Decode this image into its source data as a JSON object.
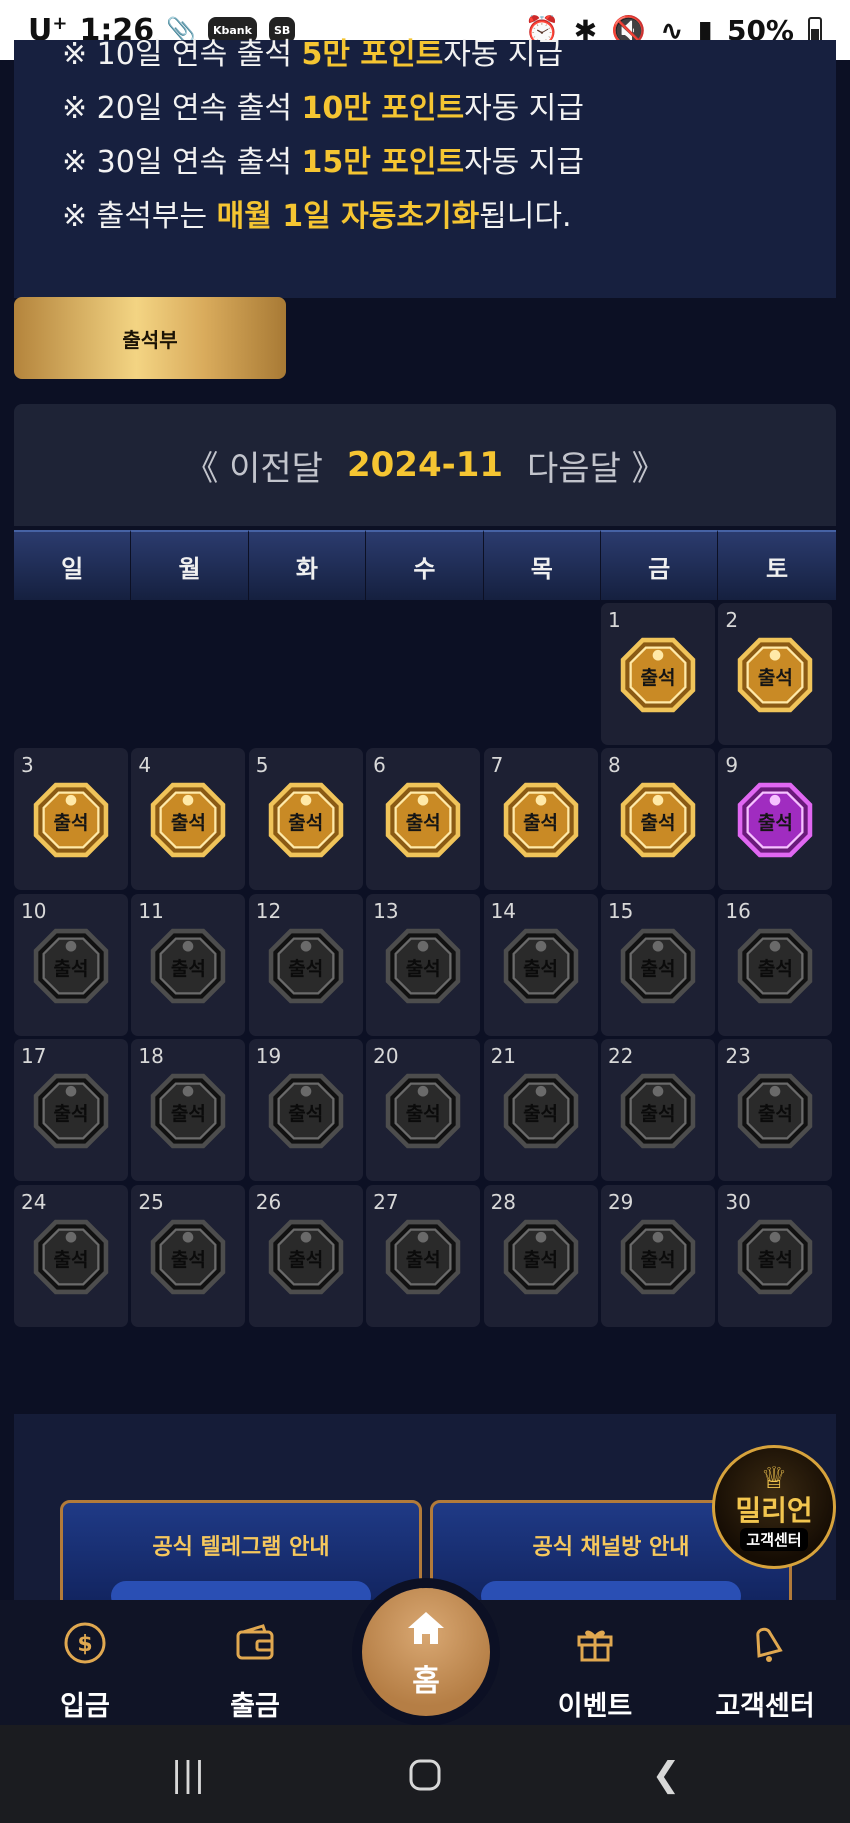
{
  "status_bar": {
    "carrier": "U",
    "carrier_sup": "+",
    "time": "1:26",
    "app_icons": [
      "Kbank",
      "SB"
    ],
    "battery": "50%"
  },
  "notice": {
    "lines": [
      {
        "prefix": "※ 10일 연속 출석 ",
        "highlight": "5만 포인트",
        "suffix": "자동 지급"
      },
      {
        "prefix": "※ 20일 연속 출석 ",
        "highlight": "10만 포인트",
        "suffix": "자동 지급"
      },
      {
        "prefix": "※ 30일 연속 출석 ",
        "highlight": "15만 포인트",
        "suffix": "자동 지급"
      },
      {
        "prefix": "※ 출석부는 ",
        "highlight": "매월 1일 자동초기화",
        "suffix": "됩니다."
      }
    ]
  },
  "attendance_button": "출석부",
  "calendar": {
    "prev_label": "《 이전달",
    "month": "2024-11",
    "next_label": "다음달 》",
    "weekdays": [
      "일",
      "월",
      "화",
      "수",
      "목",
      "금",
      "토"
    ],
    "leading_blank_days": 5,
    "badge_label": "출석",
    "days": [
      {
        "day": "1",
        "state": "gold"
      },
      {
        "day": "2",
        "state": "gold"
      },
      {
        "day": "3",
        "state": "gold"
      },
      {
        "day": "4",
        "state": "gold"
      },
      {
        "day": "5",
        "state": "gold"
      },
      {
        "day": "6",
        "state": "gold"
      },
      {
        "day": "7",
        "state": "gold"
      },
      {
        "day": "8",
        "state": "gold"
      },
      {
        "day": "9",
        "state": "purple"
      },
      {
        "day": "10",
        "state": "gray"
      },
      {
        "day": "11",
        "state": "gray"
      },
      {
        "day": "12",
        "state": "gray"
      },
      {
        "day": "13",
        "state": "gray"
      },
      {
        "day": "14",
        "state": "gray"
      },
      {
        "day": "15",
        "state": "gray"
      },
      {
        "day": "16",
        "state": "gray"
      },
      {
        "day": "17",
        "state": "gray"
      },
      {
        "day": "18",
        "state": "gray"
      },
      {
        "day": "19",
        "state": "gray"
      },
      {
        "day": "20",
        "state": "gray"
      },
      {
        "day": "21",
        "state": "gray"
      },
      {
        "day": "22",
        "state": "gray"
      },
      {
        "day": "23",
        "state": "gray"
      },
      {
        "day": "24",
        "state": "gray"
      },
      {
        "day": "25",
        "state": "gray"
      },
      {
        "day": "26",
        "state": "gray"
      },
      {
        "day": "27",
        "state": "gray"
      },
      {
        "day": "28",
        "state": "gray"
      },
      {
        "day": "29",
        "state": "gray"
      },
      {
        "day": "30",
        "state": "gray"
      }
    ]
  },
  "info_cards": [
    {
      "title": "공식 텔레그램 안내"
    },
    {
      "title": "공식 채널방 안내"
    }
  ],
  "floating_support": {
    "title": "밀리언",
    "subtitle": "고객센터"
  },
  "bottom_nav": {
    "deposit": "입금",
    "withdraw": "출금",
    "home": "홈",
    "events": "이벤트",
    "support": "고객센터"
  },
  "colors": {
    "accent_gold": "#f5c532",
    "badge_gold": "#e2a73a",
    "badge_purple": "#c23fd8",
    "badge_gray": "#3a3a3a",
    "background": "#0c1024"
  }
}
